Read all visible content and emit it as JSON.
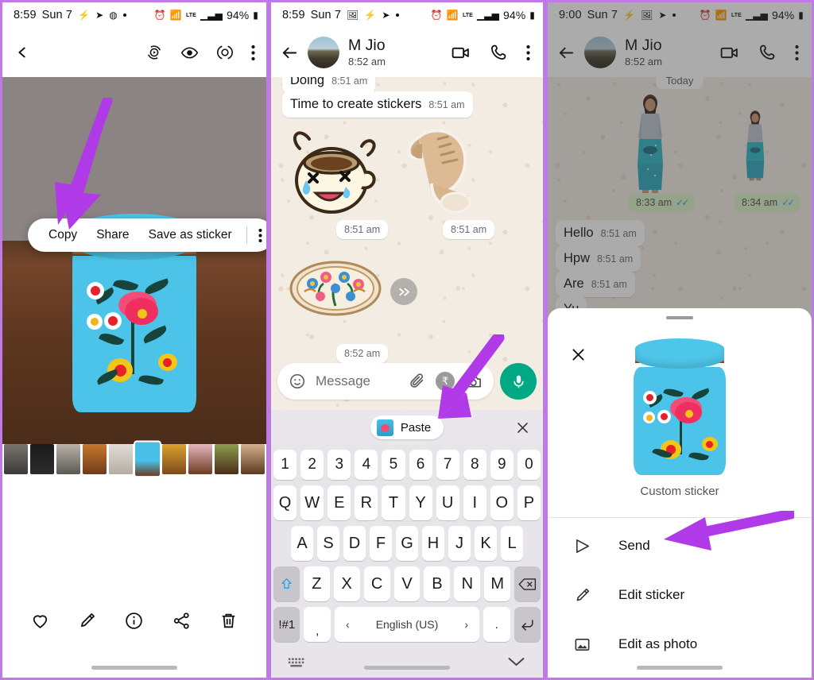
{
  "theme": {
    "accent_purple": "#b13ae8",
    "whatsapp_green": "#00a884",
    "chat_bg": "#f2ece3",
    "panel_border": "#c07ae8"
  },
  "panel1": {
    "status": {
      "time": "8:59",
      "day": "Sun 7",
      "battery": "94%",
      "network": "LTE"
    },
    "toolbar": {
      "back_icon": "back-arrow-icon",
      "icons": [
        "motion-photo-icon",
        "eye-icon",
        "lens-icon",
        "more-vert-icon"
      ]
    },
    "context_menu": {
      "items": [
        "Copy",
        "Share",
        "Save as sticker"
      ],
      "overflow_icon": "more-vert-icon"
    },
    "actions": [
      "favorite-icon",
      "edit-icon",
      "info-icon",
      "share-icon",
      "delete-icon"
    ],
    "filmstrip_count": 10
  },
  "panel2": {
    "status": {
      "time": "8:59",
      "day": "Sun 7",
      "battery": "94%",
      "network": "LTE"
    },
    "header": {
      "name": "M Jio",
      "subtitle": "8:52 am",
      "actions": [
        "video-call-icon",
        "voice-call-icon",
        "more-vert-icon"
      ]
    },
    "messages": [
      {
        "text": "Doing",
        "time": "8:51 am",
        "type": "text"
      },
      {
        "text": "Time to create stickers",
        "time": "8:51 am",
        "type": "text"
      },
      {
        "text": "",
        "time": "8:51 am",
        "type": "sticker",
        "sticker": "crying-laughing-coffee-cup"
      },
      {
        "text": "",
        "time": "8:51 am",
        "type": "sticker",
        "sticker": "cat-stretching"
      },
      {
        "text": "",
        "time": "8:52 am",
        "type": "sticker",
        "sticker": "floral-embroidery-plate"
      }
    ],
    "forward_icon": "forward-icon",
    "input": {
      "placeholder": "Message",
      "emoji_icon": "emoji-icon",
      "attach_icon": "attach-icon",
      "pay_icon": "rupee-pay-icon",
      "camera_icon": "camera-icon",
      "mic_icon": "microphone-icon"
    },
    "paste_bar": {
      "label": "Paste",
      "thumb": "clipboard-image-thumb",
      "close_icon": "close-icon"
    },
    "keyboard": {
      "row_numbers": [
        "1",
        "2",
        "3",
        "4",
        "5",
        "6",
        "7",
        "8",
        "9",
        "0"
      ],
      "row1": [
        "Q",
        "W",
        "E",
        "R",
        "T",
        "Y",
        "U",
        "I",
        "O",
        "P"
      ],
      "row2": [
        "A",
        "S",
        "D",
        "F",
        "G",
        "H",
        "J",
        "K",
        "L"
      ],
      "row3": [
        "Z",
        "X",
        "C",
        "V",
        "B",
        "N",
        "M"
      ],
      "shift_icon": "shift-icon",
      "backspace_icon": "backspace-icon",
      "symbols_key": "!#1",
      "comma_key": ",",
      "period_key": ".",
      "language": "English (US)",
      "lang_prev_icon": "chevron-left-icon",
      "lang_next_icon": "chevron-right-icon",
      "enter_icon": "enter-icon",
      "keyboard_switch_icon": "keyboard-icon",
      "hide_icon": "chevron-down-icon"
    }
  },
  "panel3": {
    "status": {
      "time": "9:00",
      "day": "Sun 7",
      "battery": "94%",
      "network": "LTE"
    },
    "header": {
      "name": "M Jio",
      "subtitle": "8:52 am",
      "actions": [
        "video-call-icon",
        "voice-call-icon",
        "more-vert-icon"
      ]
    },
    "date_chip": "Today",
    "sticker_messages": [
      {
        "time": "8:33 am",
        "status": "read",
        "sticker": "woman-in-blue-outfit"
      },
      {
        "time": "8:34 am",
        "status": "read",
        "sticker": "woman-in-blue-outfit-small"
      }
    ],
    "messages": [
      {
        "text": "Hello",
        "time": "8:51 am"
      },
      {
        "text": "Hpw",
        "time": "8:51 am"
      },
      {
        "text": "Are",
        "time": "8:51 am"
      },
      {
        "text": "Yu",
        "time": ""
      }
    ],
    "sheet": {
      "close_icon": "close-icon",
      "caption": "Custom sticker",
      "items": [
        {
          "label": "Send",
          "icon": "send-icon"
        },
        {
          "label": "Edit sticker",
          "icon": "pencil-icon"
        },
        {
          "label": "Edit as photo",
          "icon": "image-icon"
        }
      ]
    }
  }
}
